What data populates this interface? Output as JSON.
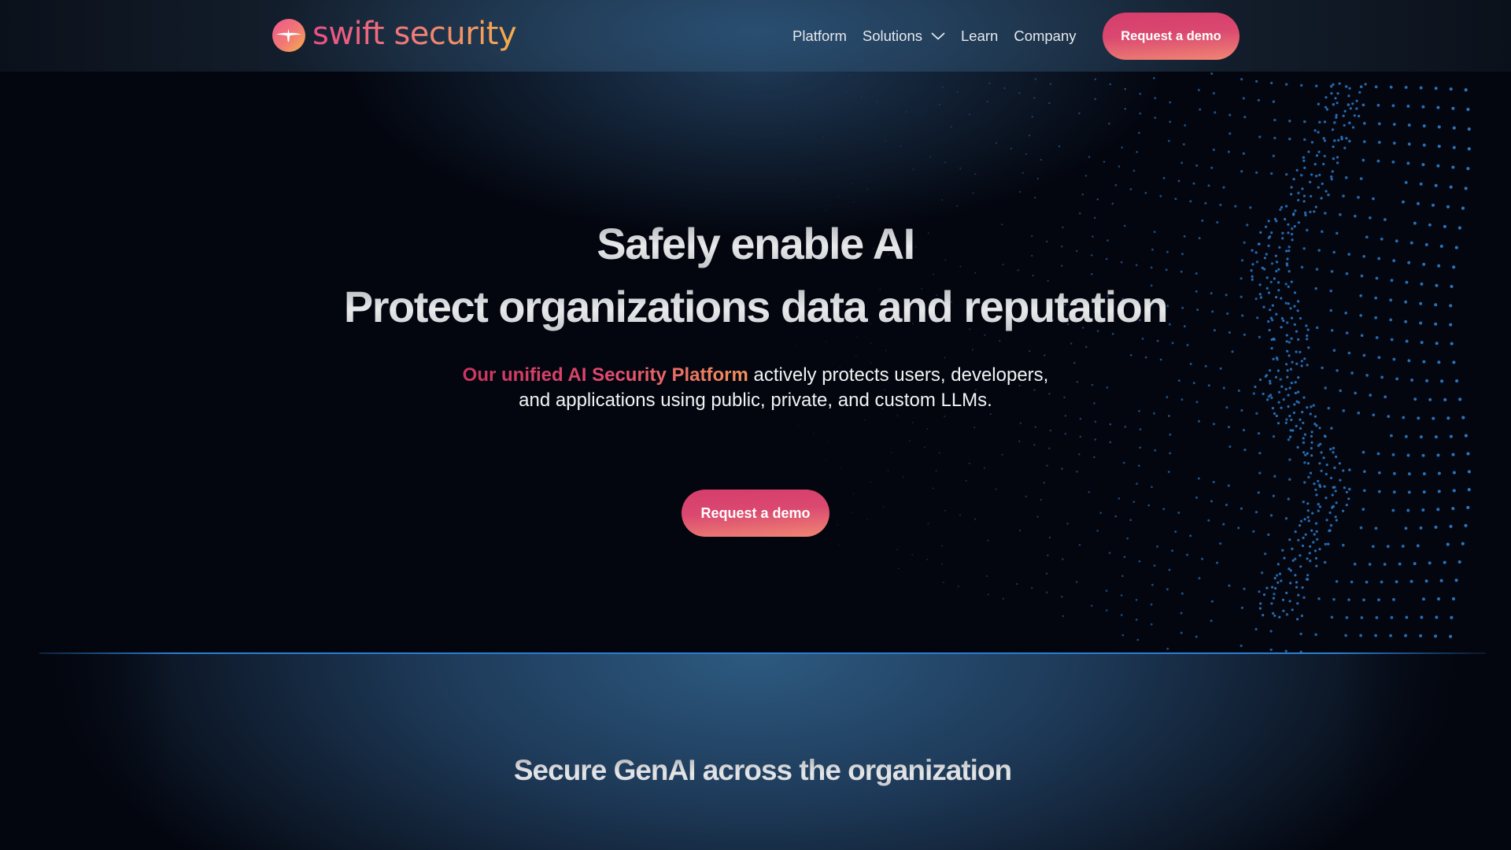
{
  "brand": {
    "name": "swift security",
    "logo_icon": "swift-bird-icon",
    "gradient": [
      "#ea4f86",
      "#f27c78",
      "#f5ae4c"
    ]
  },
  "nav": {
    "items": [
      {
        "label": "Platform",
        "has_dropdown": false
      },
      {
        "label": "Solutions",
        "has_dropdown": true,
        "icon": "chevron-down-icon"
      },
      {
        "label": "Learn",
        "has_dropdown": false
      },
      {
        "label": "Company",
        "has_dropdown": false
      }
    ],
    "cta_label": "Request a demo"
  },
  "hero": {
    "title_line1": "Safely enable AI",
    "title_line2": "Protect organizations data and reputation",
    "subtitle_highlight": "Our unified AI Security Platform",
    "subtitle_rest_line1": " actively protects users, developers,",
    "subtitle_line2": "and applications using public, private, and custom LLMs.",
    "cta_label": "Request a demo",
    "background_graphic": "dotted-face-illustration"
  },
  "section2": {
    "title": "Secure GenAI across the organization",
    "accent_line_color": "#2b7fd4"
  },
  "colors": {
    "background": "#03060f",
    "cta_gradient": [
      "#d63d6c",
      "#f08674"
    ],
    "dot_color": "#2d7fd0"
  }
}
